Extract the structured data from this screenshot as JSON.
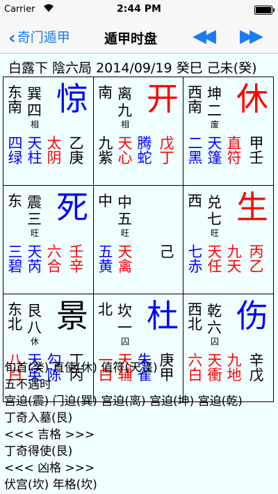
{
  "status": {
    "carrier": "Carrier",
    "time": "2:44 PM"
  },
  "nav": {
    "back_label": "奇门遁甲",
    "title": "遁甲时盘",
    "prev_symbol": "◀◀",
    "next_symbol": "▶▶"
  },
  "info": "白露下 陰六局 2014/09/19 癸巳 己未(癸)",
  "cells": [
    {
      "direction": "东南",
      "trigram": "巽",
      "number": "四",
      "state": "相",
      "door": "惊",
      "door_color": "blue",
      "bottom": [
        {
          "text": "四绿",
          "color": "blue"
        },
        {
          "text": "天柱",
          "color": "blue"
        },
        {
          "text": "太阴",
          "color": "red"
        },
        {
          "text": "乙庚",
          "color": "black"
        }
      ]
    },
    {
      "direction": "南",
      "trigram": "离",
      "number": "九",
      "state": "相",
      "door": "开",
      "door_color": "red",
      "bottom": [
        {
          "text": "九紫",
          "color": "black"
        },
        {
          "text": "天心",
          "color": "red"
        },
        {
          "text": "腾蛇",
          "color": "blue"
        },
        {
          "text": "戊丁",
          "color": "red"
        }
      ]
    },
    {
      "direction": "西南",
      "trigram": "坤",
      "number": "二",
      "state": "废",
      "door": "休",
      "door_color": "red",
      "bottom": [
        {
          "text": "二黑",
          "color": "blue"
        },
        {
          "text": "天篷",
          "color": "blue"
        },
        {
          "text": "直符",
          "color": "red"
        },
        {
          "text": "甲壬",
          "color": "black"
        }
      ]
    },
    {
      "direction": "东",
      "trigram": "震",
      "number": "三",
      "state": "旺",
      "door": "死",
      "door_color": "blue",
      "bottom": [
        {
          "text": "三碧",
          "color": "blue"
        },
        {
          "text": "天芮",
          "color": "blue"
        },
        {
          "text": "六合",
          "color": "red"
        },
        {
          "text": "壬辛",
          "color": "red"
        }
      ]
    },
    {
      "direction": "中",
      "trigram": "中",
      "number": "五",
      "state": "旺",
      "door": "",
      "door_color": "black",
      "bottom": [
        {
          "text": "五黄",
          "color": "blue"
        },
        {
          "text": "天禽",
          "color": "red"
        },
        {
          "text": "",
          "color": "black"
        },
        {
          "text": "己",
          "color": "black"
        }
      ]
    },
    {
      "direction": "西",
      "trigram": "兑",
      "number": "七",
      "state": "旺",
      "door": "生",
      "door_color": "red",
      "bottom": [
        {
          "text": "七赤",
          "color": "blue"
        },
        {
          "text": "天任",
          "color": "red"
        },
        {
          "text": "九天",
          "color": "red"
        },
        {
          "text": "丙乙",
          "color": "red"
        }
      ]
    },
    {
      "direction": "东北",
      "trigram": "艮",
      "number": "八",
      "state": "休",
      "door": "景",
      "door_color": "black",
      "bottom": [
        {
          "text": "八白",
          "color": "red"
        },
        {
          "text": "天英",
          "color": "blue"
        },
        {
          "text": "勾陈",
          "color": "blue"
        },
        {
          "text": "丁丙",
          "color": "black"
        }
      ]
    },
    {
      "direction": "北",
      "trigram": "坎",
      "number": "一",
      "state": "囚",
      "door": "杜",
      "door_color": "blue",
      "bottom": [
        {
          "text": "一白",
          "color": "red"
        },
        {
          "text": "天辅",
          "color": "red"
        },
        {
          "text": "朱雀",
          "color": "blue"
        },
        {
          "text": "庚甲",
          "color": "black"
        }
      ]
    },
    {
      "direction": "西北",
      "trigram": "乾",
      "number": "六",
      "state": "囚",
      "door": "伤",
      "door_color": "blue",
      "bottom": [
        {
          "text": "六白",
          "color": "red"
        },
        {
          "text": "天衝",
          "color": "red"
        },
        {
          "text": "九地",
          "color": "red"
        },
        {
          "text": "辛戊",
          "color": "black"
        }
      ]
    }
  ],
  "notes": [
    "旬首(癸) 直使(休) 值符(天篷)",
    "五不遇时",
    "宫迫(震) 门迫(巽) 宫迫(离) 宫迫(坤) 宫迫(乾)",
    "丁奇入墓(艮)",
    "<<< 吉格 >>>",
    "丁奇得使(艮)",
    "<<< 凶格 >>>",
    "伏宫(坎) 年格(坎)"
  ]
}
